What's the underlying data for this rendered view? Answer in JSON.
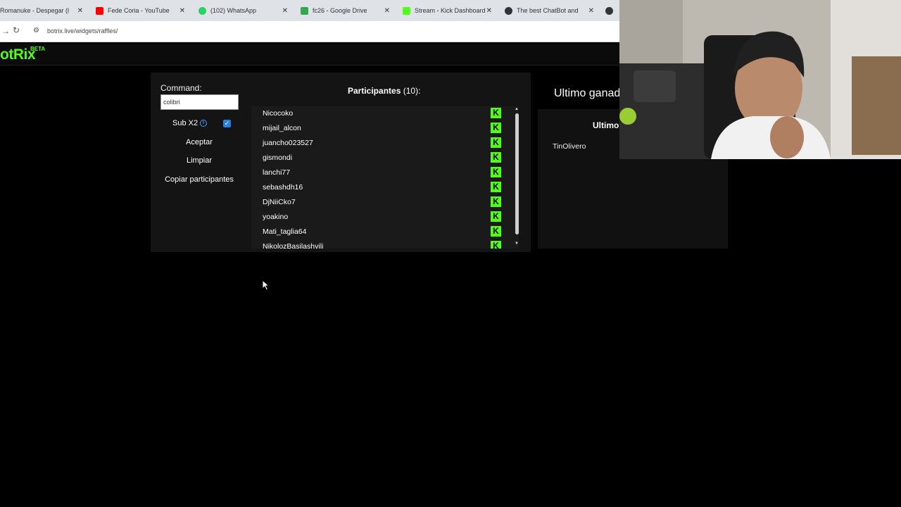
{
  "browser": {
    "tabs": [
      {
        "label": "Romanuke - Despegar (li...",
        "icon_color": "#e46a6a"
      },
      {
        "label": "Fede Coria - YouTube",
        "icon_color": "#ff0000"
      },
      {
        "label": "(102) WhatsApp",
        "icon_color": "#25d366"
      },
      {
        "label": "fc26 - Google Drive",
        "icon_color": "#34a853"
      },
      {
        "label": "Stream - Kick Dashboard",
        "icon_color": "#53fc18"
      },
      {
        "label": "The best ChatBot and Wi...",
        "icon_color": "#333333"
      }
    ],
    "close_glyph": "✕",
    "url": "botrix.live/widgets/raffles/"
  },
  "app": {
    "logo": "otRix",
    "beta": "BETA"
  },
  "form": {
    "command_label": "Command:",
    "command_value": "colibri",
    "sub_label": "Sub X2",
    "sub_checked": true,
    "accept_label": "Aceptar",
    "clear_label": "Limpiar",
    "copy_label": "Copiar participantes"
  },
  "participants": {
    "title": "Participantes",
    "count": "(10):",
    "items": [
      "Nicocoko",
      "mijail_alcon",
      "juancho023527",
      "gismondi",
      "lanchi77",
      "sebashdh16",
      "DjNiiCko7",
      "yoakino",
      "Mati_taglia64",
      "NikolozBasilashvili"
    ],
    "platform_badge": "K"
  },
  "winner": {
    "title": "Ultimo ganad",
    "subtitle": "Ultimo",
    "name": "TinOlivero"
  },
  "colors": {
    "accent": "#53fc18",
    "background": "#000000",
    "panel": "#141414"
  }
}
